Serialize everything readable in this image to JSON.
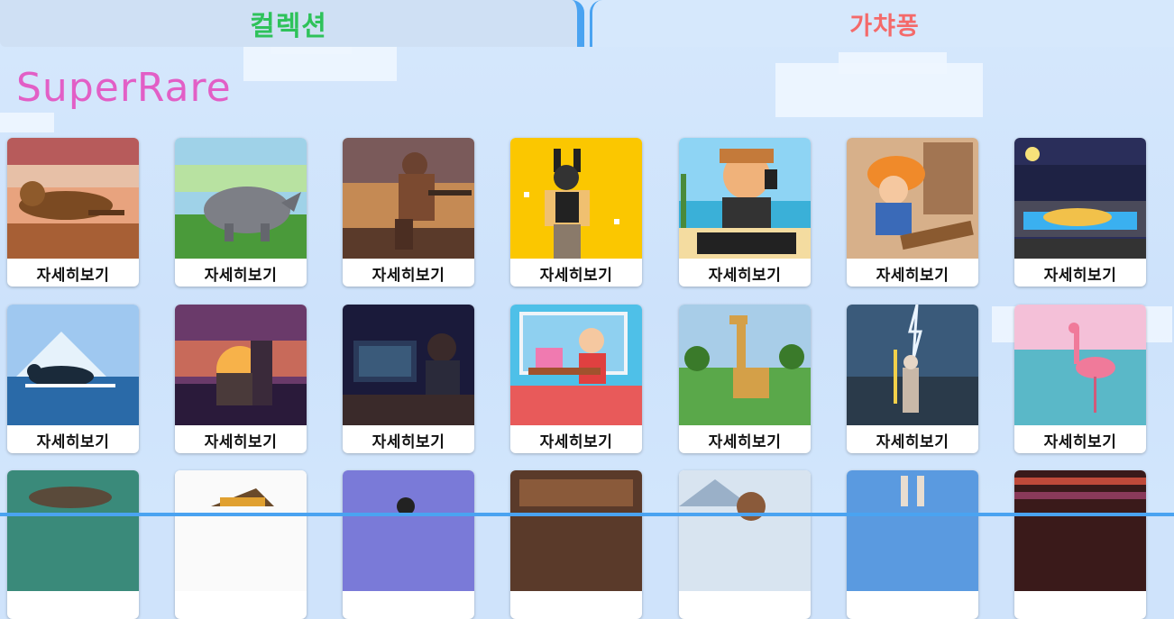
{
  "tabs": [
    {
      "label": "컬렉션"
    },
    {
      "label": "가챠퐁"
    }
  ],
  "section_title": "SuperRare",
  "card_label": "자세히보기",
  "cards": [
    {
      "subject": "lioness"
    },
    {
      "subject": "rhino"
    },
    {
      "subject": "soldier"
    },
    {
      "subject": "bunny-girl"
    },
    {
      "subject": "dj-boy"
    },
    {
      "subject": "carpenter"
    },
    {
      "subject": "night-lion"
    },
    {
      "subject": "penguin"
    },
    {
      "subject": "sunset-city"
    },
    {
      "subject": "night-coder"
    },
    {
      "subject": "desk-girl"
    },
    {
      "subject": "giraffe"
    },
    {
      "subject": "lightning-wizard"
    },
    {
      "subject": "flamingo"
    },
    {
      "subject": "turtle"
    },
    {
      "subject": "witch-hat"
    },
    {
      "subject": "purple-figure"
    },
    {
      "subject": "wood-room"
    },
    {
      "subject": "bear"
    },
    {
      "subject": "bunny"
    },
    {
      "subject": "bar-shelf"
    }
  ]
}
